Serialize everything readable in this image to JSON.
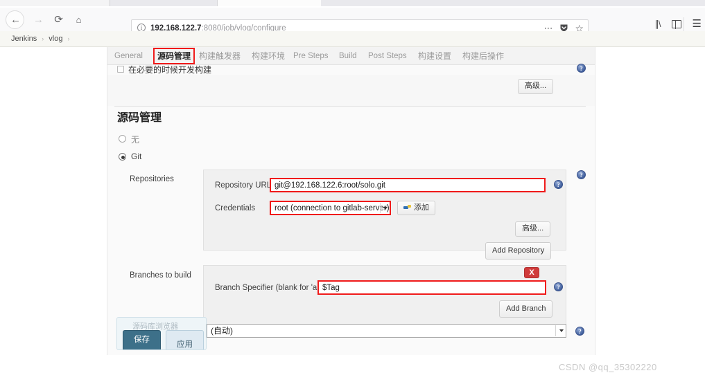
{
  "browser": {
    "back_icon": "back-arrow-icon",
    "forward_icon": "forward-arrow-icon",
    "reload_icon": "reload-icon",
    "home_icon": "home-icon",
    "url_host": "192.168.122.7",
    "url_path": ":8080/job/vlog/configure",
    "url_full": "192.168.122.7:8080/job/vlog/configure",
    "info_icon": "info-circle-icon",
    "page_actions_icon": "ellipsis-icon",
    "pocket_icon": "pocket-shield-icon",
    "bookmark_icon": "star-icon",
    "library_icon": "library-icon",
    "sidebar_icon": "sidebar-toggle-icon",
    "menu_icon": "hamburger-menu-icon"
  },
  "breadcrumb": {
    "items": [
      "Jenkins",
      "vlog"
    ],
    "separator": "›"
  },
  "tabs": [
    {
      "label": "General",
      "active": false
    },
    {
      "label": "源码管理",
      "active": true
    },
    {
      "label": "构建触发器",
      "active": false
    },
    {
      "label": "构建环境",
      "active": false
    },
    {
      "label": "Pre Steps",
      "active": false
    },
    {
      "label": "Build",
      "active": false
    },
    {
      "label": "Post Steps",
      "active": false
    },
    {
      "label": "构建设置",
      "active": false
    },
    {
      "label": "构建后操作",
      "active": false
    }
  ],
  "top_section": {
    "checkbox_label": "在必要的时候开发构建",
    "checkbox_checked": false,
    "advanced_button": "高级..."
  },
  "scm": {
    "title": "源码管理",
    "options": [
      {
        "label": "无",
        "selected": false
      },
      {
        "label": "Git",
        "selected": true
      }
    ],
    "repositories": {
      "section_label": "Repositories",
      "url_label": "Repository URL",
      "url_value": "git@192.168.122.6:root/solo.git",
      "credentials_label": "Credentials",
      "credentials_value": "root (connection to gitlab-server)",
      "add_credentials_button": "添加",
      "add_credentials_icon": "key-icon",
      "advanced_button": "高级...",
      "add_repository_button": "Add Repository"
    },
    "branches": {
      "section_label": "Branches to build",
      "specifier_label": "Branch Specifier (blank for 'any')",
      "specifier_value": "$Tag",
      "delete_button": "X",
      "add_branch_button": "Add Branch"
    },
    "browser": {
      "section_label": "源码库浏览器",
      "value": "(自动)"
    },
    "help_icon": "help-question-icon"
  },
  "savebar": {
    "save_button": "保存",
    "apply_button": "应用"
  },
  "watermark": "CSDN @qq_35302220"
}
